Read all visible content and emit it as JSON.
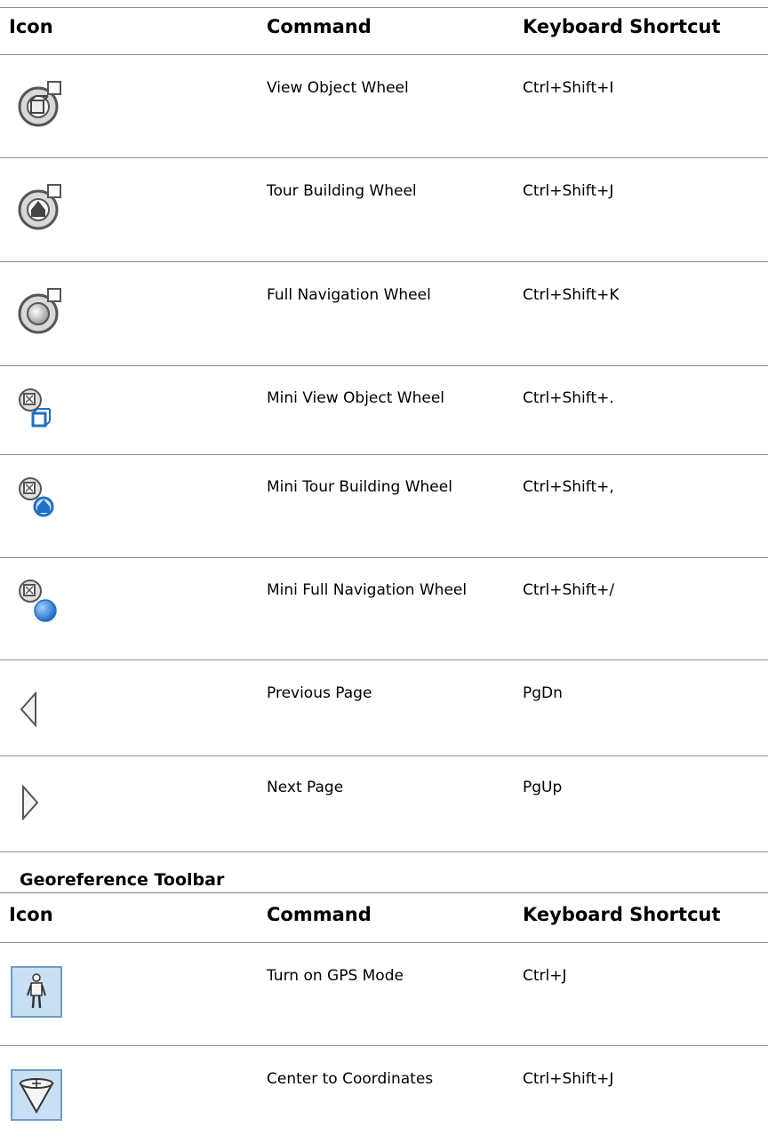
{
  "table1": {
    "headers": {
      "icon": "Icon",
      "command": "Command",
      "shortcut": "Keyboard Shortcut"
    },
    "rows": [
      {
        "icon": "view-object-wheel-icon",
        "command": "View Object Wheel",
        "shortcut": "Ctrl+Shift+I"
      },
      {
        "icon": "tour-building-wheel-icon",
        "command": "Tour Building Wheel",
        "shortcut": "Ctrl+Shift+J"
      },
      {
        "icon": "full-navigation-wheel-icon",
        "command": "Full Navigation Wheel",
        "shortcut": "Ctrl+Shift+K"
      },
      {
        "icon": "mini-view-object-wheel-icon",
        "command": "Mini View Object Wheel",
        "shortcut": "Ctrl+Shift+."
      },
      {
        "icon": "mini-tour-building-wheel-icon",
        "command": "Mini Tour Building Wheel",
        "shortcut": "Ctrl+Shift+,"
      },
      {
        "icon": "mini-full-navigation-wheel-icon",
        "command": "Mini Full Navigation Wheel",
        "shortcut": "Ctrl+Shift+/"
      },
      {
        "icon": "previous-page-icon",
        "command": "Previous Page",
        "shortcut": "PgDn"
      },
      {
        "icon": "next-page-icon",
        "command": "Next Page",
        "shortcut": "PgUp"
      }
    ]
  },
  "section2": {
    "title": "Georeference Toolbar"
  },
  "table2": {
    "headers": {
      "icon": "Icon",
      "command": "Command",
      "shortcut": "Keyboard Shortcut"
    },
    "rows": [
      {
        "icon": "gps-mode-figure-icon",
        "command": "Turn on GPS Mode",
        "shortcut": "Ctrl+J"
      },
      {
        "icon": "center-to-coordinates-icon",
        "command": "Center to Coordinates",
        "shortcut": "Ctrl+Shift+J"
      }
    ]
  },
  "colors": {
    "rule": "#8c8c8c",
    "icon_blue": "#1f6fc4",
    "toolbar_button_bg": "#c9dff3",
    "toolbar_button_border": "#6e9cc7"
  }
}
